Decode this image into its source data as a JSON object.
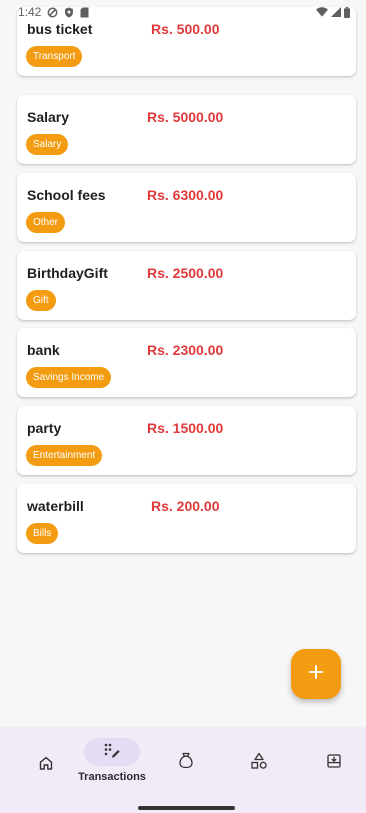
{
  "status_bar": {
    "time": "1:42"
  },
  "transactions": [
    {
      "title": "bus ticket",
      "amount": "Rs. 500.00",
      "category": "Transport"
    },
    {
      "title": "Salary",
      "amount": "Rs. 5000.00",
      "category": "Salary"
    },
    {
      "title": "School fees",
      "amount": "Rs. 6300.00",
      "category": "Other"
    },
    {
      "title": "BirthdayGift",
      "amount": "Rs. 2500.00",
      "category": "Gift"
    },
    {
      "title": "bank",
      "amount": "Rs. 2300.00",
      "category": "Savings Income"
    },
    {
      "title": "party",
      "amount": "Rs. 1500.00",
      "category": "Entertainment"
    },
    {
      "title": "waterbill",
      "amount": "Rs. 200.00",
      "category": "Bills"
    }
  ],
  "fab": {
    "icon": "plus-icon"
  },
  "bottom_nav": {
    "items": [
      {
        "id": "home",
        "icon": "home-icon"
      },
      {
        "id": "transactions",
        "icon": "transactions-icon",
        "label": "Transactions",
        "active": true
      },
      {
        "id": "budget",
        "icon": "money-bag-icon"
      },
      {
        "id": "categories",
        "icon": "shapes-icon"
      },
      {
        "id": "archive",
        "icon": "archive-icon"
      }
    ]
  },
  "colors": {
    "accent": "#f39c12",
    "amount": "#e03a3a",
    "nav_background": "#f2eaf7",
    "nav_active": "#e5dbf3"
  }
}
